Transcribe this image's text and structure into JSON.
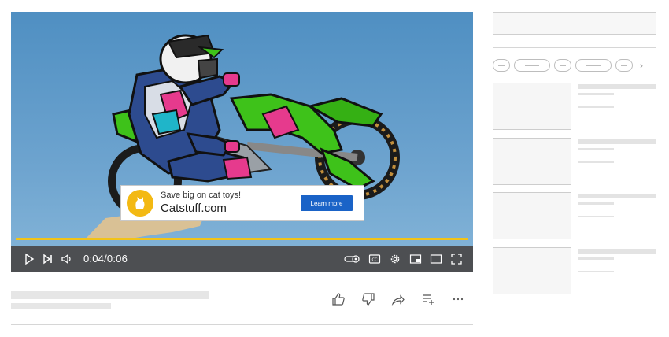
{
  "player": {
    "time": "0:04/0:06",
    "progress": 1.0
  },
  "ad": {
    "tagline": "Save big on cat toys!",
    "domain": "Catstuff.com",
    "cta": "Learn more"
  },
  "controls": {
    "left": [
      "play-icon",
      "next-icon",
      "volume-icon"
    ],
    "right": [
      "autoplay-toggle-icon",
      "captions-icon",
      "settings-gear-icon",
      "miniplayer-icon",
      "theater-mode-icon",
      "fullscreen-icon"
    ]
  },
  "actions": [
    "like-icon",
    "dislike-icon",
    "share-icon",
    "save-to-playlist-icon",
    "more-icon"
  ],
  "sidebar": {
    "chip_count": 5,
    "chevron": "›",
    "recommendations": 4
  },
  "colors": {
    "progress": "#f2c318",
    "ad_button": "#1a63c7",
    "sky": "#4f8fc2",
    "controls_bar": "#4d4f52"
  }
}
